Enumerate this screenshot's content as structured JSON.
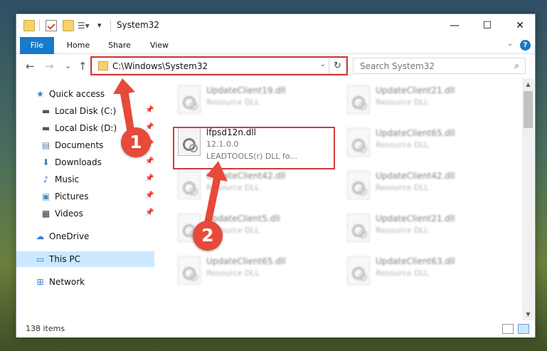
{
  "window": {
    "title": "System32",
    "controls": {
      "minimize": "—",
      "maximize": "☐",
      "close": "✕"
    }
  },
  "ribbon": {
    "tabs": [
      "File",
      "Home",
      "Share",
      "View"
    ],
    "expand": "⌄",
    "help": "?"
  },
  "navigation": {
    "back": "←",
    "forward": "→",
    "recent": "⌄",
    "up": "↑",
    "address": "C:\\Windows\\System32",
    "address_dropdown": "⌄",
    "refresh": "↻",
    "search_placeholder": "Search System32"
  },
  "sidebar": {
    "items": [
      {
        "label": "Quick access",
        "icon": "star-icon",
        "glyph": "★",
        "color": "#2f7fd3",
        "pinned": false
      },
      {
        "label": "Local Disk (C:)",
        "icon": "drive-icon",
        "glyph": "▬",
        "color": "#555555",
        "pinned": true
      },
      {
        "label": "Local Disk (D:)",
        "icon": "drive-icon",
        "glyph": "▬",
        "color": "#555555",
        "pinned": true
      },
      {
        "label": "Documents",
        "icon": "document-icon",
        "glyph": "▤",
        "color": "#5a7fa8",
        "pinned": true
      },
      {
        "label": "Downloads",
        "icon": "download-icon",
        "glyph": "⬇",
        "color": "#2f7fd3",
        "pinned": true
      },
      {
        "label": "Music",
        "icon": "music-icon",
        "glyph": "♪",
        "color": "#2f7fd3",
        "pinned": true
      },
      {
        "label": "Pictures",
        "icon": "pictures-icon",
        "glyph": "▣",
        "color": "#4a8ab8",
        "pinned": true
      },
      {
        "label": "Videos",
        "icon": "videos-icon",
        "glyph": "▦",
        "color": "#333333",
        "pinned": true
      },
      {
        "label": "OneDrive",
        "icon": "cloud-icon",
        "glyph": "☁",
        "color": "#2f7fd3",
        "pinned": false
      },
      {
        "label": "This PC",
        "icon": "computer-icon",
        "glyph": "▭",
        "color": "#2f7fd3",
        "pinned": false,
        "selected": true
      },
      {
        "label": "Network",
        "icon": "network-icon",
        "glyph": "⊞",
        "color": "#2f7fd3",
        "pinned": false
      }
    ]
  },
  "files": [
    {
      "name": "UpdateClient19.dll",
      "type": "Resource DLL",
      "blurred": true
    },
    {
      "name": "UpdateClient21.dll",
      "type": "Resource DLL",
      "blurred": true
    },
    {
      "name": "lfpsd12n.dll",
      "version": "12.1.0.0",
      "description": "LEADTOOLS(r) DLL fo...",
      "blurred": false
    },
    {
      "name": "UpdateClient65.dll",
      "type": "Resource DLL",
      "blurred": true
    },
    {
      "name": "UpdateClient42.dll",
      "type": "Resource DLL",
      "blurred": true
    },
    {
      "name": "UpdateClient42.dll",
      "type": "Resource DLL",
      "blurred": true
    },
    {
      "name": "UpdateClient5.dll",
      "type": "Resource DLL",
      "blurred": true
    },
    {
      "name": "UpdateClient21.dll",
      "type": "Resource DLL",
      "blurred": true
    },
    {
      "name": "UpdateClient65.dll",
      "type": "Resource DLL",
      "blurred": true
    },
    {
      "name": "UpdateClient63.dll",
      "type": "Resource DLL",
      "blurred": true
    }
  ],
  "status": {
    "item_count": "138 items"
  },
  "annotations": {
    "marker1": "1",
    "marker2": "2",
    "color": "#d23a3a"
  }
}
